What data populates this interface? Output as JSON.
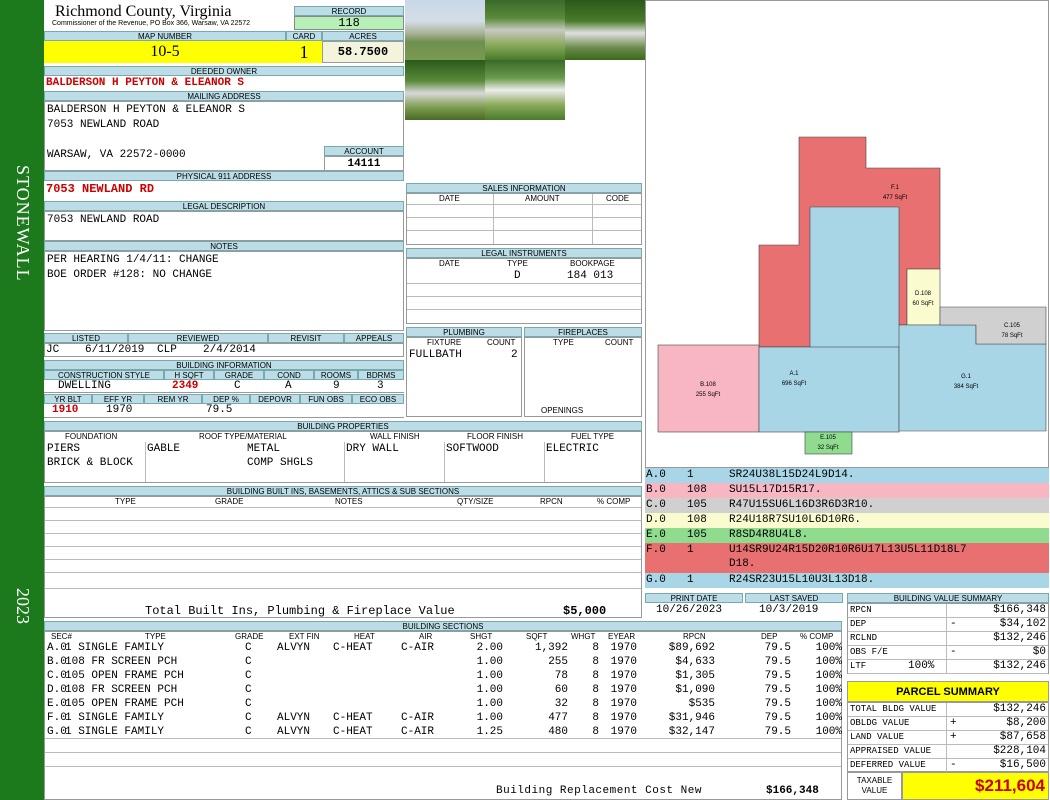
{
  "county": "Richmond County, Virginia",
  "commissioner": "Commissioner of the Revenue, PO Box 366, Warsaw, VA 22572",
  "district": "STONEWALL",
  "year": "2023",
  "record": {
    "label": "RECORD",
    "value": "118"
  },
  "map_number": {
    "label": "MAP NUMBER",
    "value": "10-5"
  },
  "card": {
    "label": "CARD",
    "value": "1"
  },
  "acres": {
    "label": "ACRES",
    "value": "58.7500"
  },
  "deeded_owner": {
    "label": "DEEDED OWNER",
    "value": "BALDERSON H PEYTON & ELEANOR S"
  },
  "mailing": {
    "label": "MAILING ADDRESS",
    "line1": "BALDERSON H PEYTON & ELEANOR S",
    "line2": "7053 NEWLAND ROAD",
    "line3": "WARSAW, VA 22572-0000"
  },
  "account": {
    "label": "ACCOUNT",
    "value": "14111"
  },
  "physical": {
    "label": "PHYSICAL 911 ADDRESS",
    "value": "7053 NEWLAND RD"
  },
  "legal": {
    "label": "LEGAL DESCRIPTION",
    "value": "7053 NEWLAND ROAD"
  },
  "notes": {
    "label": "NOTES",
    "line1": "PER HEARING 1/4/11: CHANGE",
    "line2": "BOE ORDER #128: NO CHANGE"
  },
  "listing": {
    "listed_label": "LISTED",
    "reviewed_label": "REVIEWED",
    "revisit_label": "REVISIT",
    "appeals_label": "APPEALS",
    "listed_by": "JC",
    "listed_date": "6/11/2019",
    "reviewed_by": "CLP",
    "reviewed_date": "2/4/2014"
  },
  "building_info": {
    "label": "BUILDING INFORMATION",
    "h": [
      "CONSTRUCTION STYLE",
      "H SQFT",
      "GRADE",
      "COND",
      "ROOMS",
      "BDRMS"
    ],
    "v": [
      "DWELLING",
      "2349",
      "C",
      "A",
      "9",
      "3"
    ],
    "h2": [
      "YR BLT",
      "EFF YR",
      "REM YR",
      "DEP %",
      "DEPOVR",
      "FUN OBS",
      "ECO OBS"
    ],
    "v2": [
      "1910",
      "1970",
      "",
      "79.5",
      "",
      "",
      ""
    ]
  },
  "sales": {
    "label": "SALES INFORMATION",
    "h": [
      "DATE",
      "AMOUNT",
      "CODE"
    ]
  },
  "legal_inst": {
    "label": "LEGAL INSTRUMENTS",
    "h": [
      "DATE",
      "TYPE",
      "BOOKPAGE"
    ],
    "type": "D",
    "bookpage": "184 013"
  },
  "plumbing": {
    "label": "PLUMBING",
    "h": [
      "FIXTURE",
      "COUNT"
    ],
    "fixture": "FULLBATH",
    "count": "2"
  },
  "fireplaces": {
    "label": "FIREPLACES",
    "h": [
      "TYPE",
      "COUNT"
    ],
    "openings": "OPENINGS"
  },
  "props": {
    "label": "BUILDING PROPERTIES",
    "h": [
      "FOUNDATION",
      "ROOF TYPE/MATERIAL",
      "WALL FINISH",
      "FLOOR FINISH",
      "FUEL TYPE"
    ],
    "foundation1": "PIERS",
    "foundation2": "BRICK & BLOCK",
    "roof_type": "GABLE",
    "roof_mat1": "METAL",
    "roof_mat2": "COMP SHGLS",
    "wall": "DRY WALL",
    "floor": "SOFTWOOD",
    "fuel": "ELECTRIC"
  },
  "builtins": {
    "label": "BUILDING BUILT INS, BASEMENTS, ATTICS & SUB SECTIONS",
    "h": [
      "TYPE",
      "GRADE",
      "NOTES",
      "QTY/SIZE",
      "RPCN",
      "% COMP"
    ],
    "total_label": "Total Built Ins, Plumbing & Fireplace Value",
    "total_value": "$5,000"
  },
  "dates": {
    "print_label": "PRINT DATE",
    "saved_label": "LAST SAVED",
    "print": "10/26/2023",
    "saved": "10/3/2019"
  },
  "sections": {
    "label": "BUILDING SECTIONS",
    "h": [
      "SEC#",
      "TYPE",
      "GRADE",
      "EXT FIN",
      "HEAT",
      "AIR",
      "SHGT",
      "SQFT",
      "WHGT",
      "EYEAR",
      "RPCN",
      "DEP",
      "% COMP"
    ],
    "rows": [
      [
        "A.0",
        "1 SINGLE FAMILY",
        "C",
        "ALVYN",
        "C-HEAT",
        "C-AIR",
        "2.00",
        "1,392",
        "8",
        "1970",
        "$89,692",
        "79.5",
        "100%"
      ],
      [
        "B.0",
        "108 FR SCREEN PCH",
        "C",
        "",
        "",
        "",
        "1.00",
        "255",
        "8",
        "1970",
        "$4,633",
        "79.5",
        "100%"
      ],
      [
        "C.0",
        "105 OPEN FRAME PCH",
        "C",
        "",
        "",
        "",
        "1.00",
        "78",
        "8",
        "1970",
        "$1,305",
        "79.5",
        "100%"
      ],
      [
        "D.0",
        "108 FR SCREEN PCH",
        "C",
        "",
        "",
        "",
        "1.00",
        "60",
        "8",
        "1970",
        "$1,090",
        "79.5",
        "100%"
      ],
      [
        "E.0",
        "105 OPEN FRAME PCH",
        "C",
        "",
        "",
        "",
        "1.00",
        "32",
        "8",
        "1970",
        "$535",
        "79.5",
        "100%"
      ],
      [
        "F.0",
        "1 SINGLE FAMILY",
        "C",
        "ALVYN",
        "C-HEAT",
        "C-AIR",
        "1.00",
        "477",
        "8",
        "1970",
        "$31,946",
        "79.5",
        "100%"
      ],
      [
        "G.0",
        "1 SINGLE FAMILY",
        "C",
        "ALVYN",
        "C-HEAT",
        "C-AIR",
        "1.25",
        "480",
        "8",
        "1970",
        "$32,147",
        "79.5",
        "100%"
      ]
    ],
    "brcn_label": "Building Replacement Cost New",
    "brcn": "$166,348"
  },
  "sketch_legend": [
    {
      "id": "A.0",
      "n": "1",
      "code": "SR24U38L15D24L9D14.",
      "color": "#a9d6e6"
    },
    {
      "id": "B.0",
      "n": "108",
      "code": "SU15L17D15R17.",
      "color": "#f7b6c2"
    },
    {
      "id": "C.0",
      "n": "105",
      "code": "R47U15SU6L16D3R6D3R10.",
      "color": "#d0d0d0"
    },
    {
      "id": "D.0",
      "n": "108",
      "code": "R24U18R7SU10L6D10R6.",
      "color": "#fbfbd0"
    },
    {
      "id": "E.0",
      "n": "105",
      "code": "R8SD4R8U4L8.",
      "color": "#8fdc8f"
    },
    {
      "id": "F.0",
      "n": "1",
      "code": "U14SR9U24R15D20R10R6U17L13U5L11D18L7",
      "code2": "D18.",
      "color": "#e87070"
    },
    {
      "id": "G.0",
      "n": "1",
      "code": "R24SR23U15L10U3L13D18.",
      "color": "#a9d6e6"
    }
  ],
  "sketch": {
    "shapes": [
      {
        "label": "F.1",
        "area": "477 SqFt"
      },
      {
        "label": "A.1",
        "area": "696 SqFt"
      },
      {
        "label": "B.108",
        "area": "255 SqFt"
      },
      {
        "label": "D.108",
        "area": "60 SqFt"
      },
      {
        "label": "G.1",
        "area": "384 SqFt"
      },
      {
        "label": "C.105",
        "area": "78 SqFt"
      },
      {
        "label": "E.105",
        "area": "32 SqFt"
      }
    ]
  },
  "bvs": {
    "label": "BUILDING VALUE SUMMARY",
    "rows": [
      {
        "k": "RPCN",
        "s": "",
        "v": "$166,348"
      },
      {
        "k": "DEP",
        "s": "-",
        "v": "$34,102"
      },
      {
        "k": "RCLND",
        "s": "",
        "v": "$132,246"
      },
      {
        "k": "OBS F/E",
        "s": "-",
        "v": "$0"
      },
      {
        "k": "LTF",
        "s": "100%",
        "v": "$132,246"
      }
    ]
  },
  "parcel": {
    "label": "PARCEL SUMMARY",
    "rows": [
      {
        "k": "TOTAL BLDG VALUE",
        "s": "",
        "v": "$132,246"
      },
      {
        "k": "OBLDG VALUE",
        "s": "+",
        "v": "$8,200"
      },
      {
        "k": "LAND VALUE",
        "s": "+",
        "v": "$87,658"
      },
      {
        "k": "APPRAISED VALUE",
        "s": "",
        "v": "$228,104"
      },
      {
        "k": "DEFERRED VALUE",
        "s": "-",
        "v": "$16,500"
      }
    ],
    "taxable_label": "TAXABLE VALUE",
    "taxable": "$211,604"
  }
}
